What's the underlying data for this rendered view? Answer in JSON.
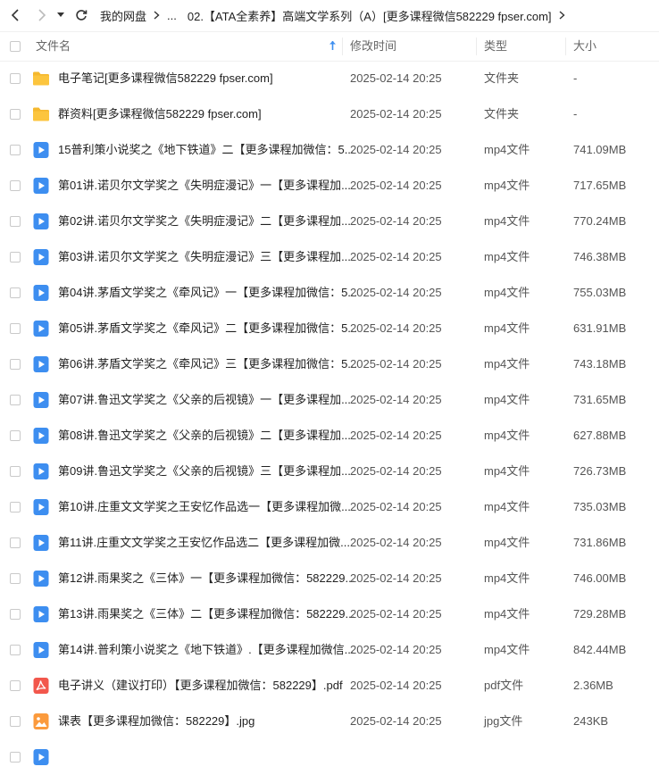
{
  "breadcrumb": {
    "root": "我的网盘",
    "ellipsis": "...",
    "current": "02.【ATA全素养】高端文学系列（A）[更多课程微信582229 fpser.com]"
  },
  "columns": {
    "name": "文件名",
    "time": "修改时间",
    "type": "类型",
    "size": "大小"
  },
  "sort": {
    "column": "name",
    "direction": "ascending"
  },
  "colors": {
    "folder": "#f5b82e",
    "video": "#3d8ef0",
    "pdf": "#f2574c",
    "image": "#fb9a3c"
  },
  "files": [
    {
      "icon": "folder",
      "name": "电子笔记[更多课程微信582229 fpser.com]",
      "time": "2025-02-14 20:25",
      "type": "文件夹",
      "size": "-"
    },
    {
      "icon": "folder",
      "name": "群资料[更多课程微信582229 fpser.com]",
      "time": "2025-02-14 20:25",
      "type": "文件夹",
      "size": "-"
    },
    {
      "icon": "video",
      "name": "15普利策小说奖之《地下铁道》二【更多课程加微信：5...",
      "time": "2025-02-14 20:25",
      "type": "mp4文件",
      "size": "741.09MB"
    },
    {
      "icon": "video",
      "name": "第01讲.诺贝尔文学奖之《失明症漫记》一【更多课程加...",
      "time": "2025-02-14 20:25",
      "type": "mp4文件",
      "size": "717.65MB"
    },
    {
      "icon": "video",
      "name": "第02讲.诺贝尔文学奖之《失明症漫记》二【更多课程加...",
      "time": "2025-02-14 20:25",
      "type": "mp4文件",
      "size": "770.24MB"
    },
    {
      "icon": "video",
      "name": "第03讲.诺贝尔文学奖之《失明症漫记》三【更多课程加...",
      "time": "2025-02-14 20:25",
      "type": "mp4文件",
      "size": "746.38MB"
    },
    {
      "icon": "video",
      "name": "第04讲.茅盾文学奖之《牵风记》一【更多课程加微信：5...",
      "time": "2025-02-14 20:25",
      "type": "mp4文件",
      "size": "755.03MB"
    },
    {
      "icon": "video",
      "name": "第05讲.茅盾文学奖之《牵风记》二【更多课程加微信：5...",
      "time": "2025-02-14 20:25",
      "type": "mp4文件",
      "size": "631.91MB"
    },
    {
      "icon": "video",
      "name": "第06讲.茅盾文学奖之《牵风记》三【更多课程加微信：5...",
      "time": "2025-02-14 20:25",
      "type": "mp4文件",
      "size": "743.18MB"
    },
    {
      "icon": "video",
      "name": "第07讲.鲁迅文学奖之《父亲的后视镜》一【更多课程加...",
      "time": "2025-02-14 20:25",
      "type": "mp4文件",
      "size": "731.65MB"
    },
    {
      "icon": "video",
      "name": "第08讲.鲁迅文学奖之《父亲的后视镜》二【更多课程加...",
      "time": "2025-02-14 20:25",
      "type": "mp4文件",
      "size": "627.88MB"
    },
    {
      "icon": "video",
      "name": "第09讲.鲁迅文学奖之《父亲的后视镜》三【更多课程加...",
      "time": "2025-02-14 20:25",
      "type": "mp4文件",
      "size": "726.73MB"
    },
    {
      "icon": "video",
      "name": "第10讲.庄重文文学奖之王安忆作品选一【更多课程加微...",
      "time": "2025-02-14 20:25",
      "type": "mp4文件",
      "size": "735.03MB"
    },
    {
      "icon": "video",
      "name": "第11讲.庄重文文学奖之王安忆作品选二【更多课程加微...",
      "time": "2025-02-14 20:25",
      "type": "mp4文件",
      "size": "731.86MB"
    },
    {
      "icon": "video",
      "name": "第12讲.雨果奖之《三体》一【更多课程加微信：582229...",
      "time": "2025-02-14 20:25",
      "type": "mp4文件",
      "size": "746.00MB"
    },
    {
      "icon": "video",
      "name": "第13讲.雨果奖之《三体》二【更多课程加微信：582229...",
      "time": "2025-02-14 20:25",
      "type": "mp4文件",
      "size": "729.28MB"
    },
    {
      "icon": "video",
      "name": "第14讲.普利策小说奖之《地下铁道》.【更多课程加微信...",
      "time": "2025-02-14 20:25",
      "type": "mp4文件",
      "size": "842.44MB"
    },
    {
      "icon": "pdf",
      "name": "电子讲义（建议打印）【更多课程加微信：582229】.pdf",
      "time": "2025-02-14 20:25",
      "type": "pdf文件",
      "size": "2.36MB"
    },
    {
      "icon": "image",
      "name": "课表【更多课程加微信：582229】.jpg",
      "time": "2025-02-14 20:25",
      "type": "jpg文件",
      "size": "243KB"
    },
    {
      "icon": "video",
      "name": "",
      "time": "",
      "type": "",
      "size": ""
    }
  ]
}
